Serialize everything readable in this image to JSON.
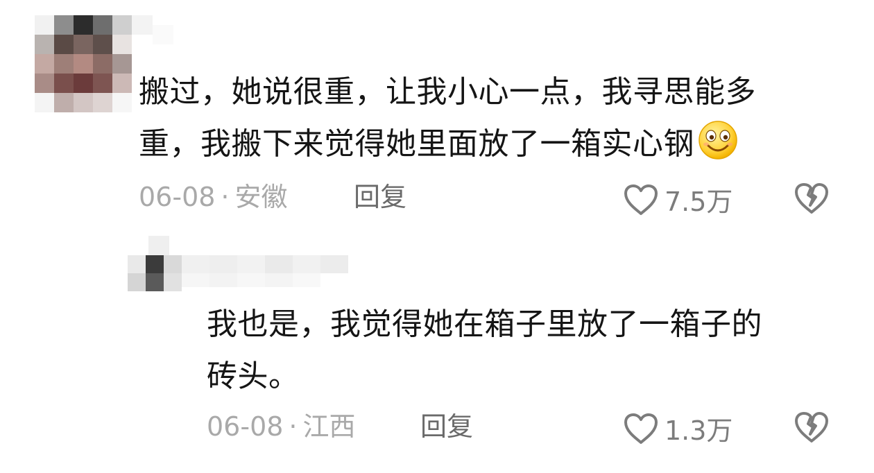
{
  "comments": [
    {
      "text_lines": [
        "搬过，她说很重，让我小心一点，我寻思能多",
        "重，我搬下来觉得她里面放了一箱实心钢"
      ],
      "emoji": "grinning-face-icon",
      "date": "06-08",
      "separator": "·",
      "location": "安徽",
      "reply_label": "回复",
      "like_count": "7.5万"
    },
    {
      "text_lines": [
        "我也是，我觉得她在箱子里放了一箱子的",
        "砖头。"
      ],
      "date": "06-08",
      "separator": "·",
      "location": "江西",
      "reply_label": "回复",
      "like_count": "1.3万"
    }
  ],
  "colors": {
    "text": "#151515",
    "meta": "#a9a9a9",
    "reply": "#6a6a6a",
    "icon": "#7c7c7c",
    "background": "#ffffff"
  }
}
